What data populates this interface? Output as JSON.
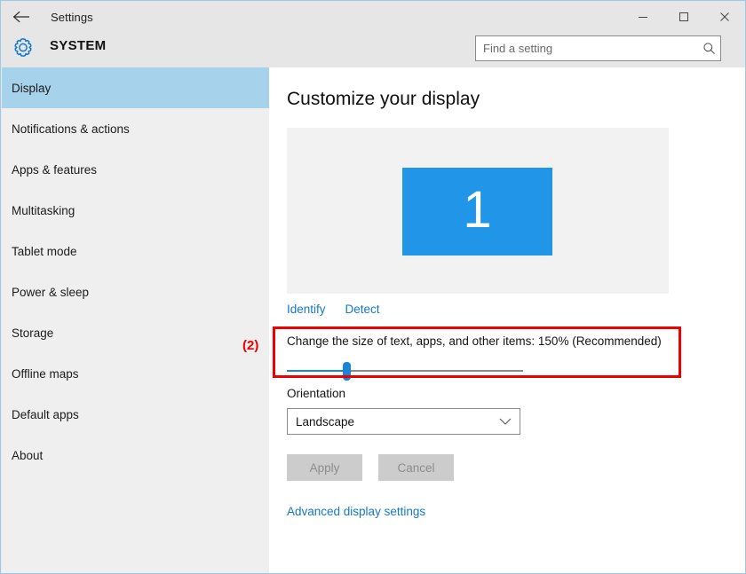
{
  "window": {
    "app_title": "Settings",
    "back_icon": "back-arrow-icon",
    "minimize_label": "–",
    "maximize_label": "☐",
    "close_label": "✕"
  },
  "header": {
    "gear_icon": "gear-icon",
    "section_title": "SYSTEM",
    "search": {
      "value": "",
      "placeholder": "Find a setting",
      "icon": "search-icon"
    }
  },
  "sidebar": {
    "items": [
      {
        "label": "Display",
        "selected": true
      },
      {
        "label": "Notifications & actions",
        "selected": false
      },
      {
        "label": "Apps & features",
        "selected": false
      },
      {
        "label": "Multitasking",
        "selected": false
      },
      {
        "label": "Tablet mode",
        "selected": false
      },
      {
        "label": "Power & sleep",
        "selected": false
      },
      {
        "label": "Storage",
        "selected": false
      },
      {
        "label": "Offline maps",
        "selected": false
      },
      {
        "label": "Default apps",
        "selected": false
      },
      {
        "label": "About",
        "selected": false
      }
    ]
  },
  "content": {
    "page_title": "Customize your display",
    "monitor": {
      "number": "1",
      "color": "#2196e8"
    },
    "preview_links": {
      "identify": "Identify",
      "detect": "Detect"
    },
    "scaling": {
      "label": "Change the size of text, apps, and other items: 150% (Recommended)",
      "value_percent": "150%",
      "recommended": "(Recommended)",
      "slider_position_percent": 25
    },
    "orientation": {
      "label": "Orientation",
      "selected": "Landscape",
      "chevron_icon": "chevron-down-icon"
    },
    "buttons": {
      "apply": "Apply",
      "cancel": "Cancel"
    },
    "advanced_link": "Advanced display settings"
  },
  "annotation": {
    "label": "(2)",
    "color": "#ee0000"
  }
}
